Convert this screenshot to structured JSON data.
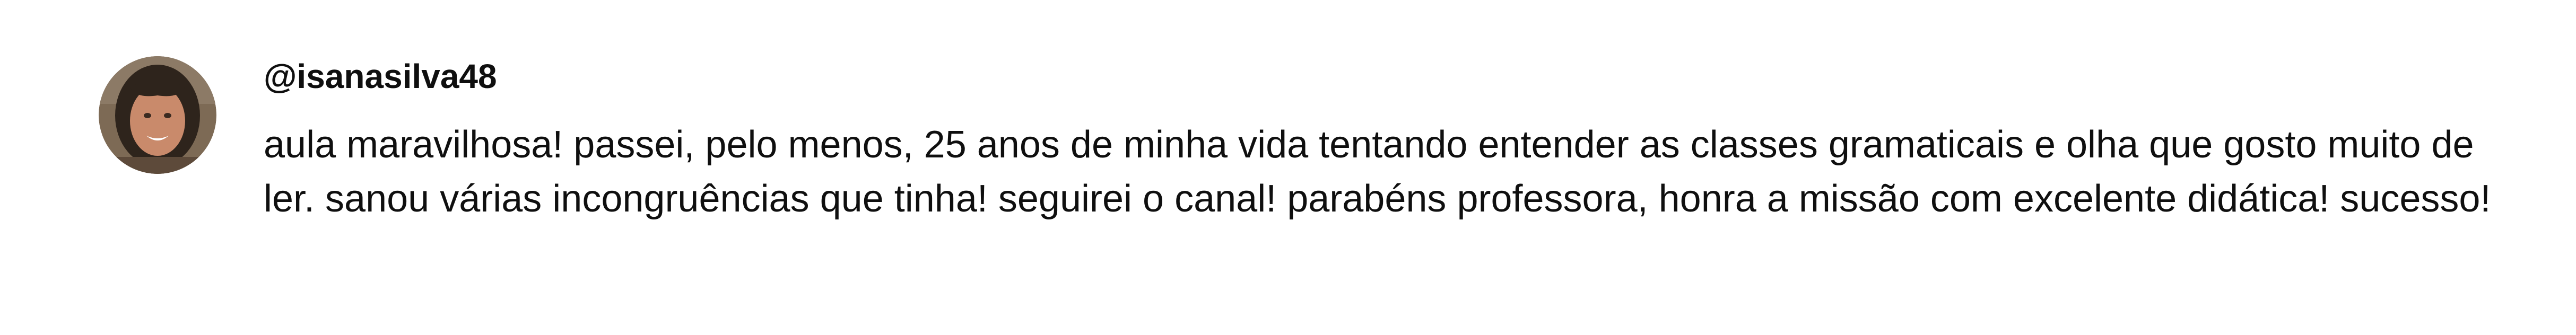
{
  "comment": {
    "author": "@isanasilva48",
    "avatar_icon": "user-avatar-photo",
    "text": "aula maravilhosa! passei, pelo menos, 25 anos de minha vida tentando entender as classes gramaticais e olha que gosto muito de ler. sanou várias incongruências que tinha! seguirei o canal! parabéns professora, honra a missão com excelente didática! sucesso!"
  }
}
